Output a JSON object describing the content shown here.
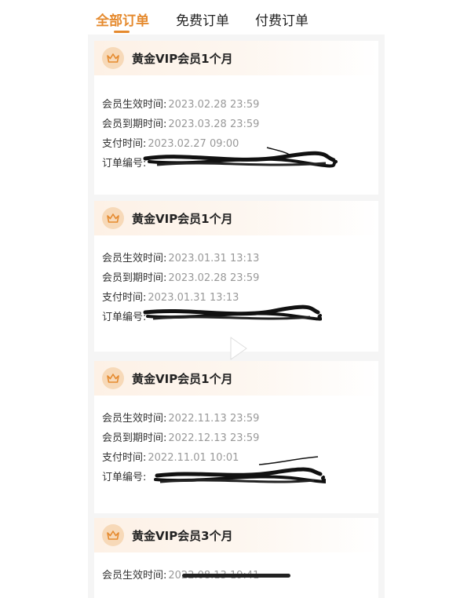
{
  "tabs": [
    {
      "label": "全部订单",
      "active": true
    },
    {
      "label": "免费订单",
      "active": false
    },
    {
      "label": "付费订单",
      "active": false
    }
  ],
  "labels": {
    "start": "会员生效时间:",
    "end": "会员到期时间:",
    "pay": "支付时间:",
    "order_no": "订单编号:"
  },
  "orders": [
    {
      "title": "黄金VIP会员1个月",
      "start": "2023.02.28 23:59",
      "end": "2023.03.28 23:59",
      "pay": "2023.02.27 09:00"
    },
    {
      "title": "黄金VIP会员1个月",
      "start": "2023.01.31 13:13",
      "end": "2023.02.28 23:59",
      "pay": "2023.01.31 13:13"
    },
    {
      "title": "黄金VIP会员1个月",
      "start": "2022.11.13 23:59",
      "end": "2022.12.13 23:59",
      "pay": "2022.11.01 10:01"
    },
    {
      "title": "黄金VIP会员3个月",
      "start": "2022.08.13 19:41"
    }
  ],
  "colors": {
    "accent": "#e58a2e",
    "badge": "#f7d9b8",
    "value": "#999999"
  },
  "icons": {
    "badge": "crown-icon",
    "video": "play-icon"
  }
}
